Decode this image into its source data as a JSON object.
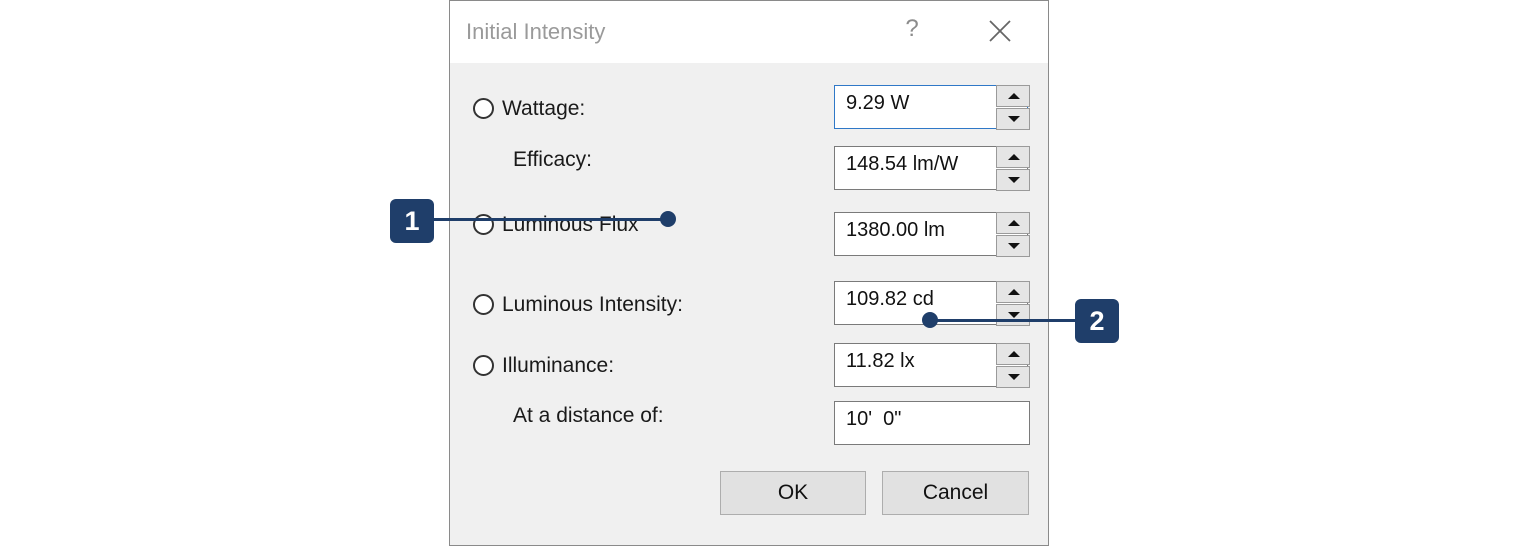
{
  "dialog": {
    "title": "Initial Intensity",
    "help_label": "?"
  },
  "rows": {
    "wattage": {
      "label": "Wattage:",
      "value": "9.29 W"
    },
    "efficacy": {
      "label": "Efficacy:",
      "value": "148.54 lm/W"
    },
    "flux": {
      "label": "Luminous Flux",
      "value": "1380.00 lm"
    },
    "intensity": {
      "label": "Luminous Intensity:",
      "value": "109.82 cd"
    },
    "illuminance": {
      "label": "Illuminance:",
      "value": "11.82 lx"
    },
    "distance": {
      "label": "At a distance of:",
      "value": "10'  0\""
    }
  },
  "buttons": {
    "ok": "OK",
    "cancel": "Cancel"
  },
  "callouts": {
    "one": "1",
    "two": "2"
  },
  "colors": {
    "callout": "#1f3e6a",
    "focus_border": "#2f78c7"
  }
}
